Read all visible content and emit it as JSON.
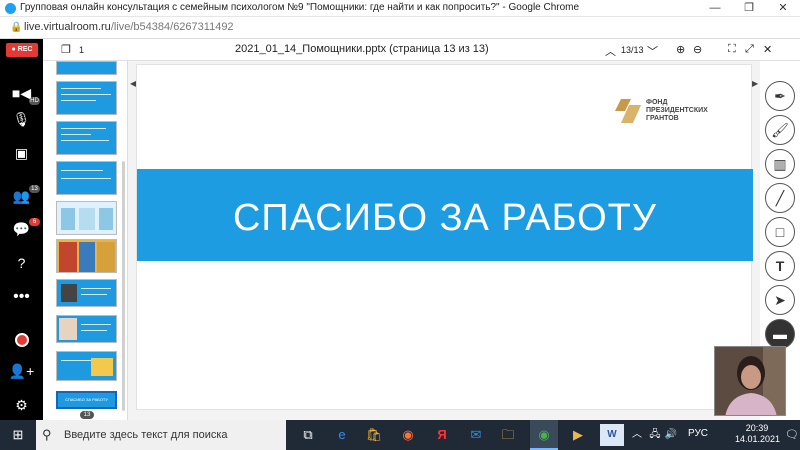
{
  "browser": {
    "window_title": "Групповая онлайн консультация с семейным психологом №9 \"Помощники: где найти и как попросить?\" - Google Chrome",
    "url_host": "live.virtualroom.ru",
    "url_path": "/live/b54384/6267311492",
    "minimize": "—",
    "restore": "❐",
    "close": "✕"
  },
  "sidebar": {
    "rec_label": "REC",
    "participants_badge": "13",
    "chat_badge": "6",
    "cam_badge": "HD"
  },
  "doc_toolbar": {
    "page_count_icon_label": "1",
    "document_title": "2021_01_14_Помощники.pptx (страница 13 из 13)",
    "page_indicator": "13/13"
  },
  "thumbnails": {
    "current_slide_number": "13",
    "last_slide_caption": "СПАСИБО ЗА РАБОТУ"
  },
  "slide": {
    "heading": "СПАСИБО ЗА РАБОТУ",
    "logo_line1": "ФОНД",
    "logo_line2": "ПРЕЗИДЕНТСКИХ",
    "logo_line3": "ГРАНТОВ",
    "band_color": "#1d9ce1"
  },
  "taskbar": {
    "search_placeholder": "Введите здесь текст для поиска",
    "language": "РУС",
    "time": "20:39",
    "date": "14.01.2021"
  }
}
